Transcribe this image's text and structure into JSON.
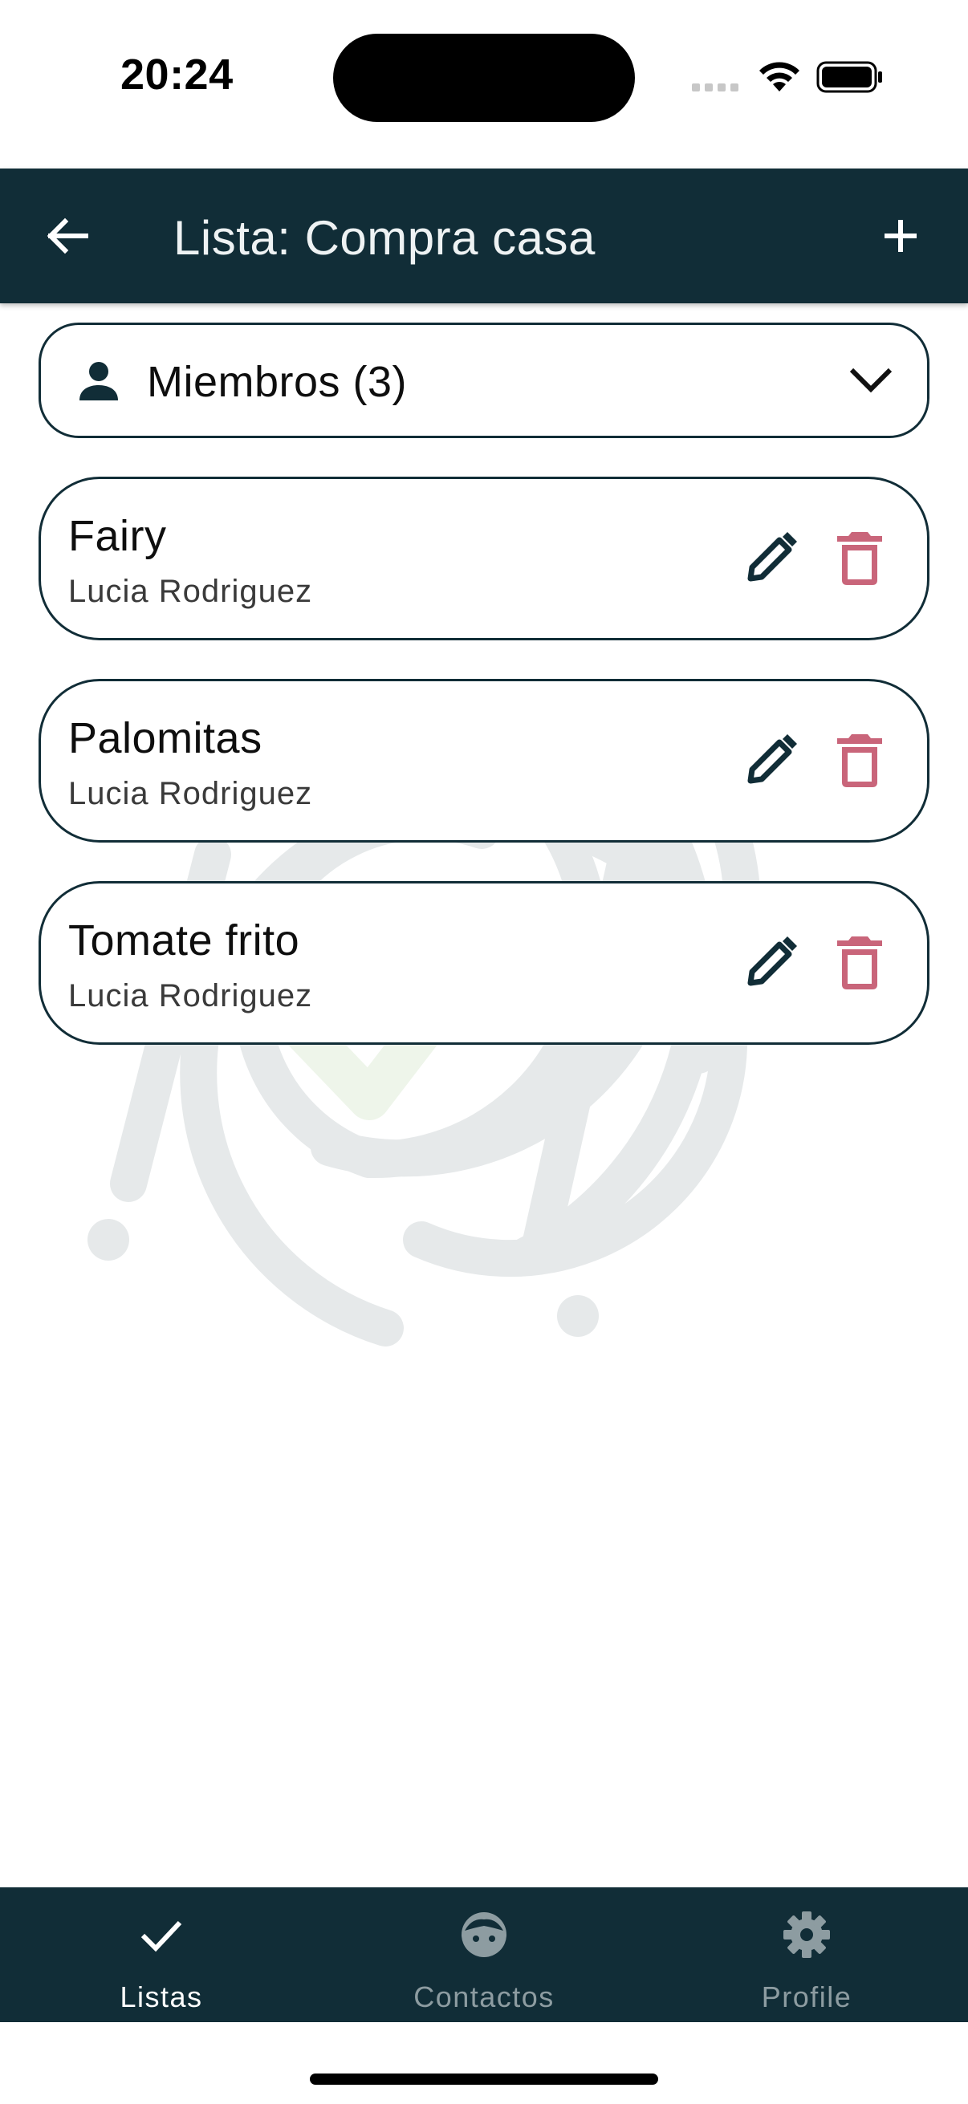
{
  "status_bar": {
    "time": "20:24"
  },
  "app_bar": {
    "title": "Lista: Compra casa"
  },
  "members": {
    "label": "Miembros (3)"
  },
  "items": [
    {
      "name": "Fairy",
      "owner": "Lucia Rodriguez"
    },
    {
      "name": "Palomitas",
      "owner": "Lucia Rodriguez"
    },
    {
      "name": "Tomate frito",
      "owner": "Lucia Rodriguez"
    }
  ],
  "bottom_nav": [
    {
      "label": "Listas",
      "icon": "check-icon",
      "active": true
    },
    {
      "label": "Contactos",
      "icon": "face-icon",
      "active": false
    },
    {
      "label": "Profile",
      "icon": "gear-icon",
      "active": false
    }
  ],
  "colors": {
    "primary": "#112d37",
    "delete": "#c9657a",
    "watermark_gray": "#e6e9ea",
    "watermark_green": "#eef5ea"
  }
}
